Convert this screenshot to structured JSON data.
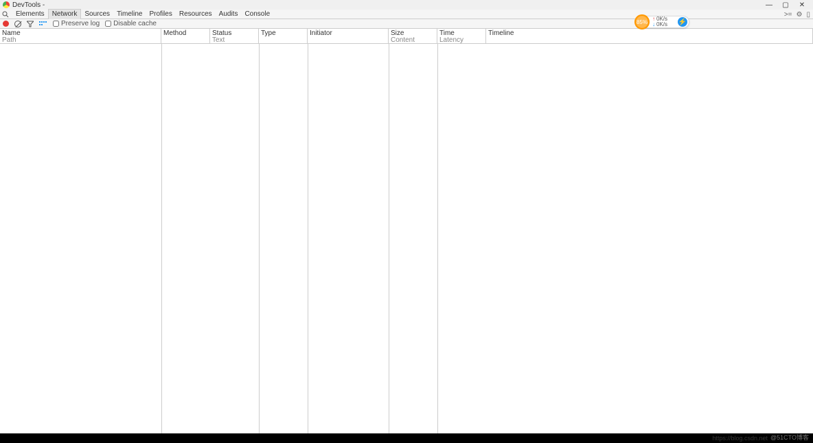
{
  "window": {
    "title": "DevTools -",
    "buttons": {
      "min": "—",
      "max": "▢",
      "close": "✕"
    }
  },
  "tabs": {
    "search_icon": "search-icon",
    "items": [
      "Elements",
      "Network",
      "Sources",
      "Timeline",
      "Profiles",
      "Resources",
      "Audits",
      "Console"
    ],
    "active_index": 1,
    "right": {
      "drawer": ">=",
      "settings": "⚙",
      "dock": "▯"
    }
  },
  "toolbar": {
    "record": "record-icon",
    "clear": "clear-icon",
    "filter": "filter-icon",
    "view": "view-icon",
    "preserve": {
      "label": "Preserve log",
      "checked": false
    },
    "cache": {
      "label": "Disable cache",
      "checked": false
    }
  },
  "columns": {
    "name": {
      "h": "Name",
      "sub": "Path"
    },
    "method": {
      "h": "Method",
      "sub": ""
    },
    "status": {
      "h": "Status",
      "sub": "Text"
    },
    "type": {
      "h": "Type",
      "sub": ""
    },
    "initiator": {
      "h": "Initiator",
      "sub": ""
    },
    "size": {
      "h": "Size",
      "sub": "Content"
    },
    "time": {
      "h": "Time",
      "sub": "Latency"
    },
    "timeline": {
      "h": "Timeline",
      "sub": ""
    }
  },
  "speed": {
    "percent": "85%",
    "up": "0K/s",
    "down": "0K/s",
    "accel": "⚡"
  },
  "footer": {
    "watermark": "@51CTO博客",
    "watermark2": "https://blog.csdn.net"
  }
}
